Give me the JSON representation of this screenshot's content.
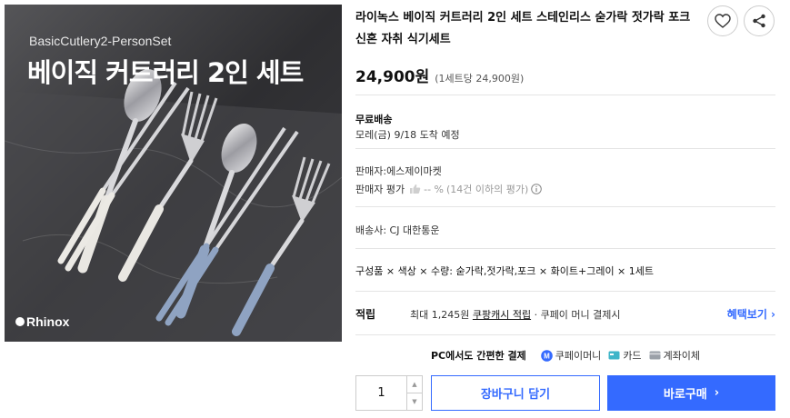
{
  "image": {
    "subtitle": "BasicCutlery2-PersonSet",
    "title": "베이직 커트러리 2인 세트",
    "brand": "Rhinox"
  },
  "product": {
    "title": "라이녹스 베이직 커트러리 2인 세트 스테인리스 숟가락 젓가락 포크 신혼 자취 식기세트",
    "price": "24,900원",
    "unit_price": "(1세트당 24,900원)"
  },
  "shipping": {
    "label": "무료배송",
    "eta": "모레(금) 9/18 도착 예정"
  },
  "seller": {
    "name": "판매자:에스제이마켓",
    "rating_label": "판매자 평가",
    "rating_value": "-- %",
    "rating_note": "(14건 이하의 평가)"
  },
  "carrier": "배송사:  CJ 대한통운",
  "options": "구성품 × 색상 × 수량: 숟가락,젓가락,포크 × 화이트+그레이 × 1세트",
  "reward": {
    "label": "적립",
    "prefix": "최대 1,245원",
    "link": "쿠팡캐시 적립",
    "suffix": "· 쿠페이 머니 결제시",
    "benefit": "혜택보기 ›"
  },
  "payment": {
    "title": "PC에서도 간편한 결제",
    "methods": [
      "쿠페이머니",
      "카드",
      "계좌이체"
    ]
  },
  "purchase": {
    "quantity": "1",
    "cart": "장바구니 담기",
    "buy": "바로구매",
    "buy_arrow": "›"
  },
  "colors": {
    "accent": "#346aff",
    "border": "#cccccc"
  }
}
